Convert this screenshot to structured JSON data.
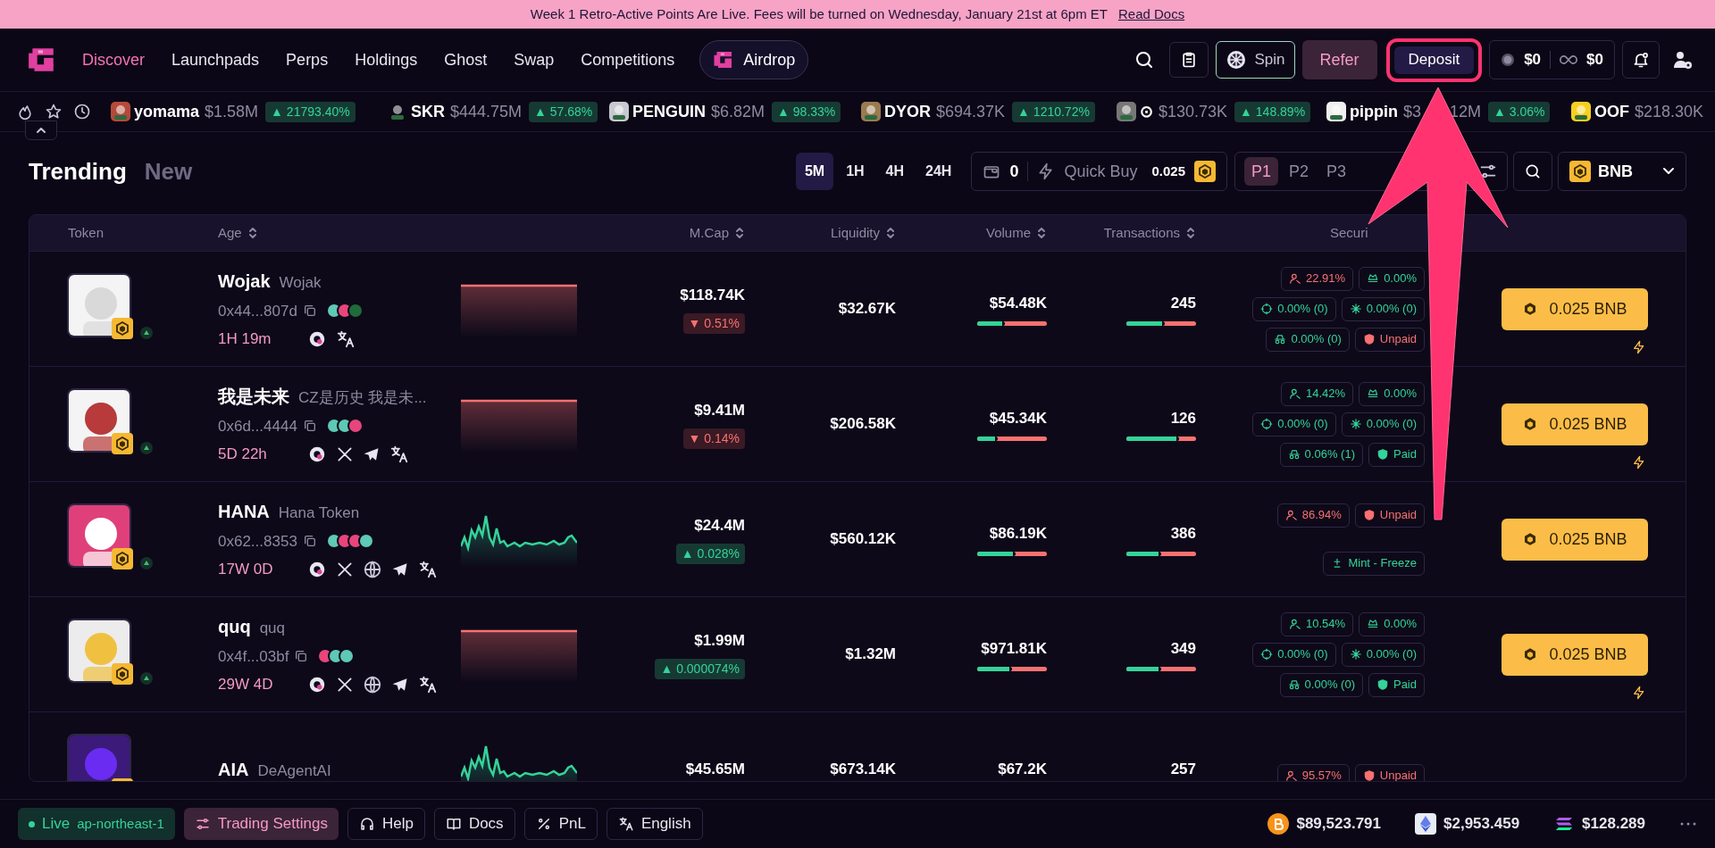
{
  "banner": {
    "text": "Week 1 Retro-Active Points Are Live. Fees will be turned on Wednesday, January 21st at 6pm ET",
    "link": "Read Docs"
  },
  "nav": {
    "items": [
      {
        "label": "Discover",
        "selected": true
      },
      {
        "label": "Launchpads",
        "selected": false
      },
      {
        "label": "Perps",
        "selected": false
      },
      {
        "label": "Holdings",
        "selected": false
      },
      {
        "label": "Ghost",
        "selected": false
      },
      {
        "label": "Swap",
        "selected": false
      },
      {
        "label": "Competitions",
        "selected": false
      }
    ],
    "airdrop": "Airdrop",
    "spin": "Spin",
    "refer": "Refer",
    "deposit": {
      "label": "Deposit",
      "highlighted": true
    },
    "balances": [
      "$0",
      "$0"
    ]
  },
  "ticker": [
    {
      "name": "yomama",
      "price": "$1.58M",
      "change": "▲ 21793.40%"
    },
    {
      "name": "SKR",
      "price": "$444.75M",
      "change": "▲ 57.68%"
    },
    {
      "name": "PENGUIN",
      "price": "$6.82M",
      "change": "▲ 98.33%"
    },
    {
      "name": "DYOR",
      "price": "$694.37K",
      "change": "▲ 1210.72%"
    },
    {
      "name": "⊙",
      "price": "$130.73K",
      "change": "▲ 148.89%"
    },
    {
      "name": "pippin",
      "price": "$3",
      "price_tail": "12M",
      "change": "▲ 3.06%"
    },
    {
      "name": "OOF",
      "price": "$218.30K"
    }
  ],
  "tabs": [
    {
      "label": "Trending",
      "selected": true
    },
    {
      "label": "New",
      "selected": false
    }
  ],
  "timeframes": [
    {
      "label": "5M",
      "selected": true
    },
    {
      "label": "1H",
      "selected": false
    },
    {
      "label": "4H",
      "selected": false
    },
    {
      "label": "24H",
      "selected": false
    }
  ],
  "quick_buy": {
    "count": "0",
    "label": "Quick Buy",
    "amount": "0.025"
  },
  "presets": [
    {
      "label": "P1",
      "selected": true
    },
    {
      "label": "P2",
      "selected": false
    },
    {
      "label": "P3",
      "selected": false
    }
  ],
  "currency": "BNB",
  "table": {
    "columns": [
      {
        "label": "Token",
        "sortable": false
      },
      {
        "label": "Age",
        "sortable": true
      },
      {
        "label": "M.Cap",
        "sortable": true
      },
      {
        "label": "Liquidity",
        "sortable": true
      },
      {
        "label": "Volume",
        "sortable": true
      },
      {
        "label": "Transactions",
        "sortable": true
      },
      {
        "label": "Securi",
        "sortable": false
      }
    ],
    "rows": [
      {
        "symbol": "Wojak",
        "name": "Wojak",
        "address": "0x44...807d",
        "dexes": [
          {
            "color": "#5ec9b5"
          },
          {
            "color": "#e8457c"
          },
          {
            "color": "#1f6b3a"
          }
        ],
        "age": "1H 19m",
        "socials": [
          {
            "kind": "scan"
          },
          {
            "kind": "translate"
          }
        ],
        "chart": {
          "kind": "flat"
        },
        "mcap": "$118.74K",
        "change": {
          "text": "▼ 0.51%",
          "kind": "down"
        },
        "liquidity": "$32.67K",
        "volume": "$54.48K",
        "volume_split": {
          "level": 0.4
        },
        "transactions": "245",
        "tx_split": {
          "level": 0.55
        },
        "security": [
          [
            {
              "kind": "holders",
              "text": "22.91%",
              "risk": true
            },
            {
              "kind": "dev",
              "text": "0.00%",
              "risk": false
            }
          ],
          [
            {
              "kind": "target",
              "text": "0.00% (0)",
              "risk": false
            },
            {
              "kind": "spark",
              "text": "0.00% (0)",
              "risk": false
            }
          ],
          [
            {
              "kind": "incognito",
              "text": "0.00% (0)",
              "risk": false
            },
            {
              "kind": "shield",
              "text": "Unpaid",
              "risk": true
            }
          ]
        ],
        "buy": "0.025 BNB",
        "bolt": true
      },
      {
        "symbol": "我是未来",
        "name": "CZ是历史 我是未...",
        "address": "0x6d...4444",
        "dexes": [
          {
            "color": "#5ec9b5"
          },
          {
            "color": "#5ec9b5"
          },
          {
            "color": "#e8457c"
          }
        ],
        "age": "5D 22h",
        "socials": [
          {
            "kind": "scan"
          },
          {
            "kind": "x"
          },
          {
            "kind": "telegram"
          },
          {
            "kind": "translate"
          }
        ],
        "chart": {
          "kind": "flat"
        },
        "mcap": "$9.41M",
        "change": {
          "text": "▼ 0.14%",
          "kind": "down"
        },
        "liquidity": "$206.58K",
        "volume": "$45.34K",
        "volume_split": {
          "level": 0.3
        },
        "transactions": "126",
        "tx_split": {
          "level": 0.75
        },
        "security": [
          [
            {
              "kind": "holders",
              "text": "14.42%",
              "risk": false
            },
            {
              "kind": "dev",
              "text": "0.00%",
              "risk": false
            }
          ],
          [
            {
              "kind": "target",
              "text": "0.00% (0)",
              "risk": false
            },
            {
              "kind": "spark",
              "text": "0.00% (0)",
              "risk": false
            }
          ],
          [
            {
              "kind": "incognito",
              "text": "0.06% (1)",
              "risk": false
            },
            {
              "kind": "shield",
              "text": "Paid",
              "risk": false
            }
          ]
        ],
        "buy": "0.025 BNB",
        "bolt": true
      },
      {
        "symbol": "HANA",
        "name": "Hana Token",
        "address": "0x62...8353",
        "dexes": [
          {
            "color": "#5ec9b5"
          },
          {
            "color": "#e8457c"
          },
          {
            "color": "#e8457c"
          },
          {
            "color": "#5ec9b5"
          }
        ],
        "age": "17W 0D",
        "socials": [
          {
            "kind": "scan"
          },
          {
            "kind": "x"
          },
          {
            "kind": "globe"
          },
          {
            "kind": "telegram"
          },
          {
            "kind": "translate"
          }
        ],
        "chart": {
          "kind": "wave"
        },
        "mcap": "$24.4M",
        "change": {
          "text": "▲ 0.028%",
          "kind": "up"
        },
        "liquidity": "$560.12K",
        "volume": "$86.19K",
        "volume_split": {
          "level": 0.55
        },
        "transactions": "386",
        "tx_split": {
          "level": 0.5
        },
        "security": [
          [
            {
              "kind": "holders",
              "text": "86.94%",
              "risk": true
            },
            {
              "kind": "shield",
              "text": "Unpaid",
              "risk": true
            }
          ],
          [
            {
              "kind": "mint",
              "text": "Mint - Freeze",
              "risk": false
            }
          ]
        ],
        "buy": "0.025 BNB",
        "bolt": false
      },
      {
        "symbol": "quq",
        "name": "quq",
        "address": "0x4f...03bf",
        "dexes": [
          {
            "color": "#e8457c"
          },
          {
            "color": "#5ec9b5"
          },
          {
            "color": "#5ec9b5"
          }
        ],
        "age": "29W 4D",
        "socials": [
          {
            "kind": "scan"
          },
          {
            "kind": "x"
          },
          {
            "kind": "globe"
          },
          {
            "kind": "telegram"
          },
          {
            "kind": "translate"
          }
        ],
        "chart": {
          "kind": "flat"
        },
        "mcap": "$1.99M",
        "change": {
          "text": "▲ 0.000074%",
          "kind": "up"
        },
        "liquidity": "$1.32M",
        "volume": "$971.81K",
        "volume_split": {
          "level": 0.5
        },
        "transactions": "349",
        "tx_split": {
          "level": 0.5
        },
        "security": [
          [
            {
              "kind": "holders",
              "text": "10.54%",
              "risk": false
            },
            {
              "kind": "dev",
              "text": "0.00%",
              "risk": false
            }
          ],
          [
            {
              "kind": "target",
              "text": "0.00% (0)",
              "risk": false
            },
            {
              "kind": "spark",
              "text": "0.00% (0)",
              "risk": false
            }
          ],
          [
            {
              "kind": "incognito",
              "text": "0.00% (0)",
              "risk": false
            },
            {
              "kind": "shield",
              "text": "Paid",
              "risk": false
            }
          ]
        ],
        "buy": "0.025 BNB",
        "bolt": true
      },
      {
        "symbol": "AIA",
        "name": "DeAgentAI",
        "chart": {
          "kind": "wave"
        },
        "mcap": "$45.65M",
        "liquidity": "$673.14K",
        "volume": "$67.2K",
        "transactions": "257",
        "security": [
          [
            {
              "kind": "holders",
              "text": "95.57%",
              "risk": true
            },
            {
              "kind": "shield",
              "text": "Unpaid",
              "risk": true
            }
          ]
        ]
      }
    ]
  },
  "annotation": {
    "kind": "arrow"
  },
  "footer": {
    "status": {
      "label": "Live",
      "region": "ap-northeast-1",
      "online": true
    },
    "items": [
      {
        "kind": "sliders",
        "label": "Trading Settings",
        "selected": true
      },
      {
        "kind": "headset",
        "label": "Help",
        "selected": false
      },
      {
        "kind": "book",
        "label": "Docs",
        "selected": false
      },
      {
        "kind": "percent",
        "label": "PnL",
        "selected": false
      },
      {
        "kind": "translate",
        "label": "English",
        "selected": false
      }
    ],
    "prices": [
      {
        "kind": "btc",
        "price": "$89,523.791"
      },
      {
        "kind": "eth",
        "price": "$2,953.459"
      },
      {
        "kind": "sol",
        "price": "$128.289"
      }
    ]
  }
}
